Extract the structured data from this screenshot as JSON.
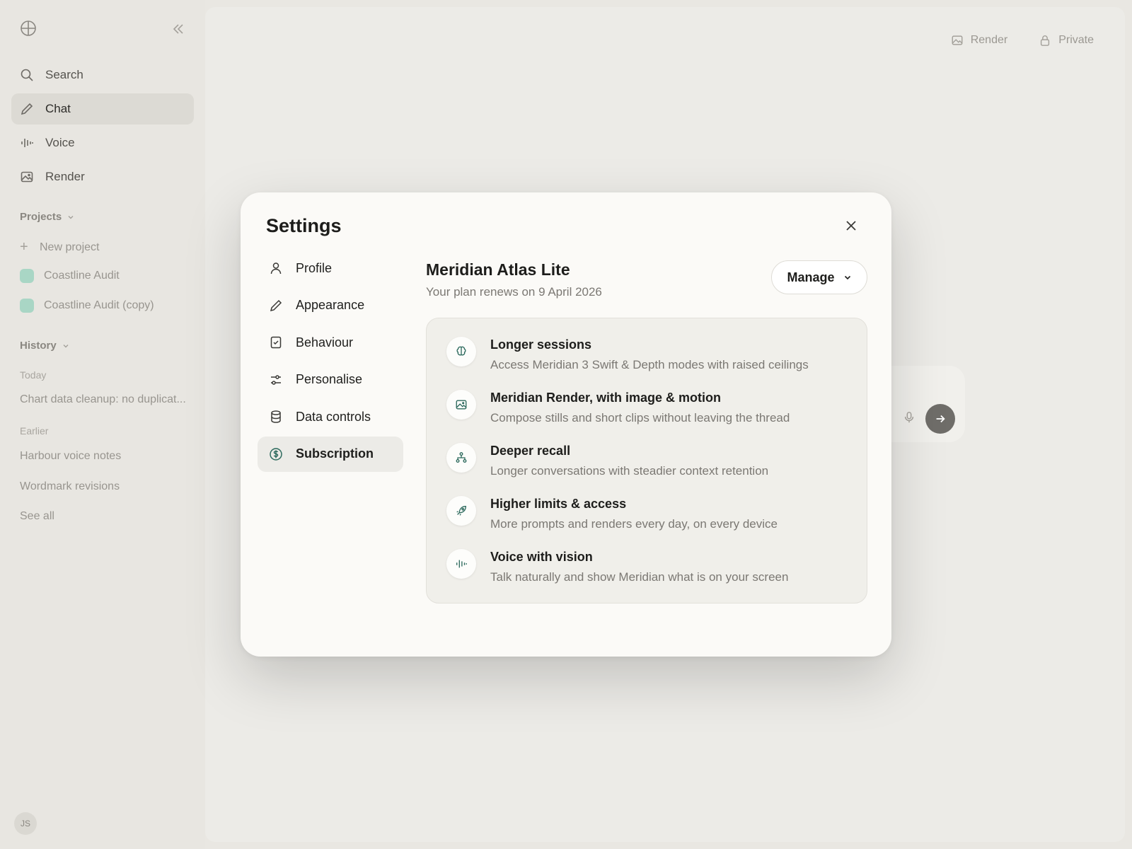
{
  "sidebar": {
    "nav": [
      {
        "label": "Search",
        "icon": "search-icon"
      },
      {
        "label": "Chat",
        "icon": "pencil-icon"
      },
      {
        "label": "Voice",
        "icon": "waveform-icon"
      },
      {
        "label": "Render",
        "icon": "image-icon"
      }
    ],
    "projects_heading": "Projects",
    "new_project": "New project",
    "projects": [
      "Coastline Audit",
      "Coastline Audit (copy)"
    ],
    "history_heading": "History",
    "today_label": "Today",
    "today_items": [
      "Chart data cleanup: no duplicat..."
    ],
    "earlier_label": "Earlier",
    "earlier_items": [
      "Harbour voice notes",
      "Wordmark revisions"
    ],
    "see_all": "See all",
    "avatar_initials": "JS"
  },
  "topbar": {
    "render_label": "Render",
    "private_label": "Private"
  },
  "settings": {
    "title": "Settings",
    "nav": [
      {
        "label": "Profile",
        "icon": "person-icon"
      },
      {
        "label": "Appearance",
        "icon": "pencil-icon"
      },
      {
        "label": "Behaviour",
        "icon": "document-check-icon"
      },
      {
        "label": "Personalise",
        "icon": "sliders-icon"
      },
      {
        "label": "Data controls",
        "icon": "database-icon"
      },
      {
        "label": "Subscription",
        "icon": "dollar-circle-icon"
      }
    ],
    "active_tab": "Subscription",
    "plan_name": "Meridian Atlas Lite",
    "plan_renewal": "Your plan renews on 9 April 2026",
    "manage_label": "Manage",
    "features": [
      {
        "title": "Longer sessions",
        "desc": "Access Meridian 3 Swift & Depth modes with raised ceilings",
        "icon": "brain-icon"
      },
      {
        "title": "Meridian Render, with image & motion",
        "desc": "Compose stills and short clips without leaving the thread",
        "icon": "image-icon"
      },
      {
        "title": "Deeper recall",
        "desc": "Longer conversations with steadier context retention",
        "icon": "hierarchy-icon"
      },
      {
        "title": "Higher limits & access",
        "desc": "More prompts and renders every day, on every device",
        "icon": "rocket-icon"
      },
      {
        "title": "Voice with vision",
        "desc": "Talk naturally and show Meridian what is on your screen",
        "icon": "waveform-icon"
      }
    ],
    "accent_color": "#2e6b5e"
  }
}
